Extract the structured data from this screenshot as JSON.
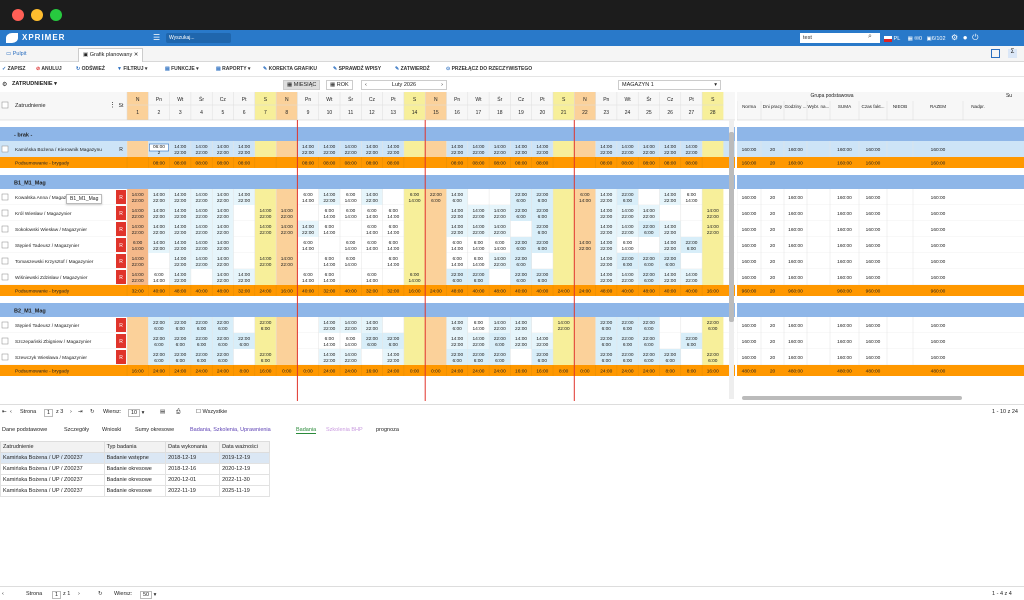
{
  "app": {
    "logo": "XPRIMER",
    "search_placeholder": "Wyszukaj...",
    "search_value": "test",
    "lang": "PL",
    "mail_count": "0",
    "user_counter": "6/102"
  },
  "tabs": [
    {
      "label": "Pulpit"
    },
    {
      "label": "Grafik planowany"
    }
  ],
  "toolbar": {
    "save": "ZAPISZ",
    "cancel": "ANULUJ",
    "refresh": "ODŚWIEŻ",
    "filter": "FILTRUJ",
    "functions": "FUNKCJE",
    "reports": "RAPORTY",
    "correct": "KOREKTA GRAFIKU",
    "check": "SPRAWDŹ WPISY",
    "approve": "ZATWIERDŹ",
    "switch": "PRZEŁĄCZ DO RZECZYWISTEGO"
  },
  "view": {
    "group_label": "ZATRUDNIENIE",
    "month": "MIESIĄC",
    "year": "ROK",
    "period": "Luty 2026",
    "warehouse": "MAGAZYN 1",
    "employee_header": "Zatrudnienie",
    "st_header": "St",
    "tooltip": "B1_M1_Mag"
  },
  "colors": {
    "accent": "#2979c9",
    "sunday": "#fbd19a",
    "saturday": "#f7ef9a",
    "holiday": "#f5b98a",
    "group_row": "#8eb6e8",
    "summary": "#ff9800",
    "highlight": "#cde4f7",
    "red": "#e0342b"
  },
  "days": [
    {
      "d": "N",
      "n": "1",
      "t": "sun"
    },
    {
      "d": "Pn",
      "n": "2",
      "t": ""
    },
    {
      "d": "Wt",
      "n": "3",
      "t": ""
    },
    {
      "d": "Śr",
      "n": "4",
      "t": ""
    },
    {
      "d": "Cz",
      "n": "5",
      "t": ""
    },
    {
      "d": "Pt",
      "n": "6",
      "t": ""
    },
    {
      "d": "S",
      "n": "7",
      "t": "sat"
    },
    {
      "d": "N",
      "n": "8",
      "t": "sun"
    },
    {
      "d": "Pn",
      "n": "9",
      "t": ""
    },
    {
      "d": "Wt",
      "n": "10",
      "t": ""
    },
    {
      "d": "Śr",
      "n": "11",
      "t": ""
    },
    {
      "d": "Cz",
      "n": "12",
      "t": ""
    },
    {
      "d": "Pt",
      "n": "13",
      "t": ""
    },
    {
      "d": "S",
      "n": "14",
      "t": "sat"
    },
    {
      "d": "N",
      "n": "15",
      "t": "sun"
    },
    {
      "d": "Pn",
      "n": "16",
      "t": ""
    },
    {
      "d": "Wt",
      "n": "17",
      "t": ""
    },
    {
      "d": "Śr",
      "n": "18",
      "t": ""
    },
    {
      "d": "Cz",
      "n": "19",
      "t": ""
    },
    {
      "d": "Pt",
      "n": "20",
      "t": ""
    },
    {
      "d": "S",
      "n": "21",
      "t": "sat"
    },
    {
      "d": "N",
      "n": "22",
      "t": "sun"
    },
    {
      "d": "Pn",
      "n": "23",
      "t": ""
    },
    {
      "d": "Wt",
      "n": "24",
      "t": ""
    },
    {
      "d": "Śr",
      "n": "25",
      "t": ""
    },
    {
      "d": "Cz",
      "n": "26",
      "t": ""
    },
    {
      "d": "Pt",
      "n": "27",
      "t": ""
    },
    {
      "d": "S",
      "n": "28",
      "t": "sat"
    }
  ],
  "groups": [
    {
      "name": "- brak -",
      "rows": [
        {
          "name": "Kamińska Bożena / Kierownik Magazynu",
          "st": "R",
          "cells": [
            "",
            "06:00 2",
            "14:00 22:00",
            "14:00 22:00",
            "14:00 22:00",
            "14:00 22:00",
            "",
            "",
            "14:00 22:00",
            "14:00 22:00",
            "14:00 22:00",
            "14:00 22:00",
            "14:00 22:00",
            "",
            "",
            "14:00 22:00",
            "14:00 22:00",
            "14:00 22:00",
            "14:00 22:00",
            "14:00 22:00",
            "",
            "",
            "14:00 22:00",
            "14:00 22:00",
            "14:00 22:00",
            "14:00 22:00",
            "14:00 22:00",
            ""
          ],
          "right": [
            "160:00",
            "20",
            "160:00",
            "",
            "160:00",
            "160:00",
            "",
            "160:00"
          ]
        }
      ],
      "summary": {
        "label": "Podsumowanie - brygady",
        "cells": [
          "",
          "08:00",
          "08:00",
          "08:00",
          "08:00",
          "08:00",
          "",
          "",
          "08:00",
          "08:00",
          "08:00",
          "08:00",
          "08:00",
          "",
          "",
          "08:00",
          "08:00",
          "08:00",
          "08:00",
          "08:00",
          "",
          "",
          "08:00",
          "08:00",
          "08:00",
          "08:00",
          "08:00",
          ""
        ],
        "right": [
          "160:00",
          "20",
          "160:00",
          "",
          "160:00",
          "160:00",
          "",
          "160:00"
        ]
      }
    },
    {
      "name": "B1_M1_Mag",
      "rows": [
        {
          "name": "Kowalska Anna / Magazynier",
          "st": "R",
          "cells": [
            "14:00 22:00",
            "14:00 22:00",
            "14:00 22:00",
            "14:00 22:00",
            "14:00 22:00",
            "14:00 22:00",
            "",
            "",
            "6:00 14:00",
            "14:00 22:00",
            "6:00 14:00",
            "14:00 22:00",
            "",
            "6:00 14:00",
            "22:00 6:00",
            "14:00 6:00",
            "",
            "",
            "22:00 6:00",
            "22:00 6:00",
            "",
            "6:00 14:00",
            "14:00 22:00",
            "22:00 6:00",
            "",
            "14:00 22:00",
            "6:00 14:00",
            ""
          ],
          "right": [
            "160:00",
            "20",
            "160:00",
            "",
            "160:00",
            "160:00",
            "",
            "160:00"
          ]
        },
        {
          "name": "Król Wiesław / Magazynier",
          "st": "R",
          "cells": [
            "14:00 22:00",
            "14:00 22:00",
            "14:00 22:00",
            "14:00 22:00",
            "14:00 22:00",
            "",
            "14:00 22:00",
            "14:00 22:00",
            "",
            "6:00 14:00",
            "6:00 14:00",
            "6:00 14:00",
            "6:00 14:00",
            "",
            "",
            "14:00 22:00",
            "14:00 22:00",
            "14:00 22:00",
            "22:00 6:00",
            "22:00 6:00",
            "",
            "",
            "14:00 22:00",
            "14:00 22:00",
            "14:00 22:00",
            "",
            "",
            "14:00 22:00"
          ],
          "right": [
            "160:00",
            "20",
            "160:00",
            "",
            "160:00",
            "160:00",
            "",
            "160:00"
          ]
        },
        {
          "name": "Sokołowski Wiesław / Magazynier",
          "st": "R",
          "cells": [
            "14:00 22:00",
            "14:00 22:00",
            "14:00 22:00",
            "14:00 22:00",
            "14:00 22:00",
            "",
            "14:00 22:00",
            "14:00 22:00",
            "14:00 22:00",
            "6:00 14:00",
            "",
            "6:00 14:00",
            "6:00 14:00",
            "",
            "",
            "14:00 22:00",
            "14:00 22:00",
            "14:00 22:00",
            "",
            "22:00 6:00",
            "",
            "",
            "14:00 22:00",
            "14:00 22:00",
            "22:00 6:00",
            "14:00 22:00",
            "",
            "14:00 22:00"
          ],
          "right": [
            "160:00",
            "20",
            "160:00",
            "",
            "160:00",
            "160:00",
            "",
            "160:00"
          ]
        },
        {
          "name": "Stępień Tadeusz / Magazynier",
          "st": "R",
          "cells": [
            "6:00 14:00",
            "14:00 22:00",
            "14:00 22:00",
            "14:00 22:00",
            "14:00 22:00",
            "",
            "",
            "",
            "6:00 14:00",
            "",
            "6:00 14:00",
            "6:00 14:00",
            "6:00 14:00",
            "",
            "",
            "6:00 14:00",
            "6:00 14:00",
            "6:00 14:00",
            "22:00 6:00",
            "22:00 6:00",
            "",
            "14:00 22:00",
            "14:00 22:00",
            "6:00 14:00",
            "",
            "14:00 22:00",
            "22:00 6:00",
            ""
          ],
          "right": [
            "160:00",
            "20",
            "160:00",
            "",
            "160:00",
            "160:00",
            "",
            "160:00"
          ]
        },
        {
          "name": "Tomaszewski Krzysztof / Magazynier",
          "st": "R",
          "cells": [
            "14:00 22:00",
            "",
            "14:00 22:00",
            "14:00 22:00",
            "14:00 22:00",
            "",
            "14:00 22:00",
            "14:00 22:00",
            "",
            "6:00 14:00",
            "6:00 14:00",
            "",
            "6:00 14:00",
            "",
            "",
            "6:00 14:00",
            "6:00 14:00",
            "14:00 22:00",
            "22:00 6:00",
            "",
            "",
            "",
            "14:00 22:00",
            "22:00 6:00",
            "22:00 6:00",
            "22:00 6:00",
            "",
            ""
          ],
          "right": [
            "160:00",
            "20",
            "160:00",
            "",
            "160:00",
            "160:00",
            "",
            "160:00"
          ]
        },
        {
          "name": "Wiśniewski Zdzisław / Magazynier",
          "st": "R",
          "cells": [
            "14:00 22:00",
            "6:00 14:00",
            "14:00 22:00",
            "",
            "14:00 22:00",
            "14:00 22:00",
            "",
            "",
            "6:00 14:00",
            "6:00 14:00",
            "",
            "6:00 14:00",
            "",
            "6:00 14:00",
            "",
            "22:00 6:00",
            "22:00 6:00",
            "",
            "22:00 6:00",
            "22:00 6:00",
            "",
            "",
            "14:00 22:00",
            "14:00 22:00",
            "22:00 6:00",
            "14:00 22:00",
            "14:00 22:00",
            ""
          ],
          "right": [
            "160:00",
            "20",
            "160:00",
            "",
            "160:00",
            "160:00",
            "",
            "160:00"
          ]
        }
      ],
      "summary": {
        "label": "Podsumowanie - brygady",
        "cells": [
          "32:00",
          "40:00",
          "48:00",
          "40:00",
          "48:00",
          "32:00",
          "24:00",
          "16:00",
          "40:00",
          "32:00",
          "40:00",
          "32:00",
          "32:00",
          "16:00",
          "24:00",
          "48:00",
          "40:00",
          "48:00",
          "40:00",
          "40:00",
          "24:00",
          "24:00",
          "48:00",
          "40:00",
          "48:00",
          "40:00",
          "40:00",
          "16:00"
        ],
        "right": [
          "960:00",
          "20",
          "960:00",
          "",
          "960:00",
          "960:00",
          "",
          "960:00"
        ]
      }
    },
    {
      "name": "B2_M1_Mag",
      "rows": [
        {
          "name": "Stępień Tadeusz / Magazynier",
          "st": "R",
          "cells": [
            "",
            "22:00 6:00",
            "22:00 6:00",
            "22:00 6:00",
            "22:00 6:00",
            "",
            "22:00 6:00",
            "",
            "",
            "14:00 22:00",
            "14:00 22:00",
            "14:00 22:00",
            "",
            "",
            "",
            "14:00 6:00",
            "6:00 14:00",
            "14:00 22:00",
            "14:00 22:00",
            "",
            "14:00 22:00",
            "",
            "22:00 6:00",
            "22:00 6:00",
            "22:00 6:00",
            "",
            "",
            "22:00 6:00"
          ],
          "right": [
            "160:00",
            "20",
            "160:00",
            "",
            "160:00",
            "160:00",
            "",
            "160:00"
          ]
        },
        {
          "name": "Szczepański Zbigniew / Magazynier",
          "st": "R",
          "cells": [
            "",
            "22:00 6:00",
            "22:00 6:00",
            "22:00 6:00",
            "22:00 6:00",
            "22:00 6:00",
            "",
            "",
            "",
            "6:00 14:00",
            "6:00 14:00",
            "22:00 6:00",
            "22:00 6:00",
            "",
            "",
            "14:00 22:00",
            "14:00 22:00",
            "22:00 6:00",
            "14:00 22:00",
            "14:00 22:00",
            "",
            "",
            "22:00 6:00",
            "22:00 6:00",
            "22:00 6:00",
            "",
            "22:00 6:00",
            ""
          ],
          "right": [
            "160:00",
            "20",
            "160:00",
            "",
            "160:00",
            "160:00",
            "",
            "160:00"
          ]
        },
        {
          "name": "Szewczyk Wiesława / Magazynier",
          "st": "R",
          "cells": [
            "",
            "22:00 6:00",
            "22:00 6:00",
            "22:00 6:00",
            "22:00 6:00",
            "",
            "22:00 6:00",
            "",
            "",
            "14:00 22:00",
            "14:00 22:00",
            "",
            "14:00 22:00",
            "",
            "",
            "22:00 6:00",
            "22:00 6:00",
            "22:00 6:00",
            "",
            "22:00 6:00",
            "",
            "",
            "22:00 6:00",
            "22:00 6:00",
            "22:00 6:00",
            "22:00 6:00",
            "",
            "22:00 6:00"
          ],
          "right": [
            "160:00",
            "20",
            "160:00",
            "",
            "160:00",
            "160:00",
            "",
            "160:00"
          ]
        }
      ],
      "summary": {
        "label": "Podsumowanie - brygady",
        "cells": [
          "16:00",
          "24:00",
          "24:00",
          "24:00",
          "24:00",
          "8:00",
          "16:00",
          "0:00",
          "0:00",
          "24:00",
          "24:00",
          "16:00",
          "24:00",
          "0:00",
          "0:00",
          "24:00",
          "24:00",
          "24:00",
          "16:00",
          "16:00",
          "8:00",
          "0:00",
          "24:00",
          "24:00",
          "24:00",
          "8:00",
          "8:00",
          "16:00"
        ],
        "right": [
          "480:00",
          "20",
          "480:00",
          "",
          "480:00",
          "480:00",
          "",
          "480:00"
        ]
      }
    }
  ],
  "right_panel": {
    "group_title": "Grupa podstawowa",
    "extra": "Su",
    "headers": [
      "Norma",
      "Dni pracy",
      "Godziny ...",
      "Wybr. na...",
      "SUMA",
      "Czas fakt...",
      "NIEOB",
      "RAZEM",
      "Nadpr."
    ]
  },
  "pager1": {
    "label": "Strona",
    "page": "1",
    "of": "z 3",
    "rows_label": "Wiersz:",
    "rows": "10",
    "all": "Wszystkie",
    "range": "1 - 10 z 24"
  },
  "detail_tabs": [
    "Dane podstawowe",
    "Szczegóły",
    "Wnioski",
    "Sumy okresowe",
    "Badania, Szkolenia, Uprawnienia",
    "Badania",
    "Szkolenia BHP",
    "prognoza"
  ],
  "detail_table": {
    "headers": [
      "Zatrudnienie",
      "Typ badania",
      "Data wykonania",
      "Data ważności"
    ],
    "rows": [
      [
        "Kamińska Bożena / UP / Z00237",
        "Badanie wstępne",
        "2018-12-19",
        "2019-12-19"
      ],
      [
        "Kamińska Bożena / UP / Z00237",
        "Badanie okresowe",
        "2018-12-16",
        "2020-12-19"
      ],
      [
        "Kamińska Bożena / UP / Z00237",
        "Badanie okresowe",
        "2020-12-01",
        "2022-11-30"
      ],
      [
        "Kamińska Bożena / UP / Z00237",
        "Badanie okresowe",
        "2022-11-19",
        "2025-11-19"
      ]
    ]
  },
  "pager2": {
    "label": "Strona",
    "page": "1",
    "of": "z 1",
    "rows_label": "Wiersz:",
    "rows": "50",
    "range": "1 - 4 z 4"
  }
}
